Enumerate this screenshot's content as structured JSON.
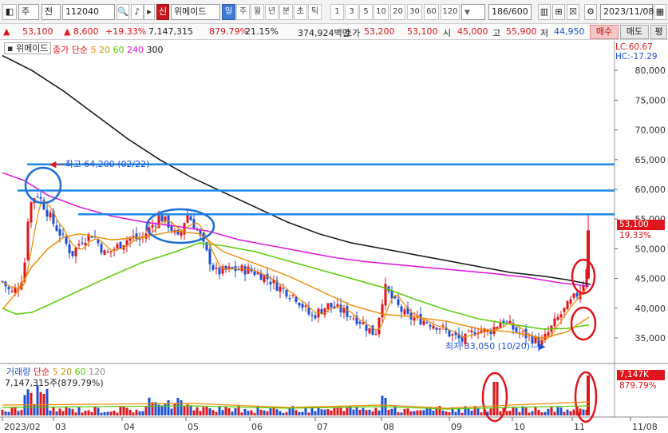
{
  "toolbar": {
    "code": "112040",
    "name": "위메이드",
    "shin_label": "신",
    "period_tabs": [
      "일",
      "주",
      "월",
      "년",
      "분",
      "초",
      "틱"
    ],
    "count_buttons": [
      "1",
      "3",
      "5",
      "10",
      "20",
      "30",
      "60",
      "120"
    ],
    "count_display": "186/600",
    "date": "2023/11/08",
    "market_label": "주",
    "prev_label": "전"
  },
  "quote": {
    "price": "53,100",
    "change": "8,600",
    "change_pct": "+19.33%",
    "volume": "7,147,315",
    "volume_pct": "879.79%",
    "turnover": "21.15%",
    "amount": "374,924백만",
    "bid_label": "호가",
    "bid1": "53,200",
    "bid2": "53,100",
    "open_label": "시",
    "open": "45,000",
    "high_label": "고",
    "high": "55,900",
    "low_label": "저",
    "low": "44,950",
    "buy_label": "매수",
    "sell_label": "매도",
    "eval_label": "평"
  },
  "price_legend": {
    "name": "위메이드",
    "ma_label": "종가 단순",
    "ma_values": [
      "5",
      "20",
      "60",
      "240",
      "300"
    ]
  },
  "corner_info": {
    "lc": "LC:60.67",
    "hc": "HC:-17.29"
  },
  "annotations": {
    "high": "최고 64,200 (02/22)",
    "low": "최저 33,050 (10/20)"
  },
  "price_badge": {
    "value": "53,100",
    "pct": "19.33%"
  },
  "volume_legend": {
    "label": "거래량",
    "ma_label": "단순",
    "ma_values": [
      "5",
      "20",
      "60",
      "120"
    ],
    "value_text": "7,147,315주(879.79%)"
  },
  "volume_badge": {
    "value": "7,147K",
    "pct": "879.79%"
  },
  "chart_data": {
    "type": "candlestick",
    "y_ticks": [
      35000,
      40000,
      45000,
      50000,
      55000,
      60000,
      65000,
      70000,
      75000,
      80000
    ],
    "y_tick_labels": [
      "35,000",
      "40,000",
      "45,000",
      "50,000",
      "55,000",
      "60,000",
      "65,000",
      "70,000",
      "75,000",
      "80,000"
    ],
    "x_tick_labels": [
      "2023/02",
      "03",
      "04",
      "05",
      "06",
      "07",
      "08",
      "09",
      "10",
      "11",
      "11/08"
    ],
    "colors": {
      "up": "#e0151b",
      "down": "#1b4fd6",
      "ma5": "#f08a00",
      "ma20": "#9a9a9a",
      "ma60": "#55cc00",
      "ma240": "#dd11dd",
      "ma300": "#111111",
      "hline": "#1e88e5",
      "circle": "#e0151b",
      "ellipse": "#1e6fd6"
    },
    "horizontal_lines": [
      64200,
      59800,
      55800
    ],
    "last_close": 53100,
    "high": 64200,
    "low": 33050
  }
}
